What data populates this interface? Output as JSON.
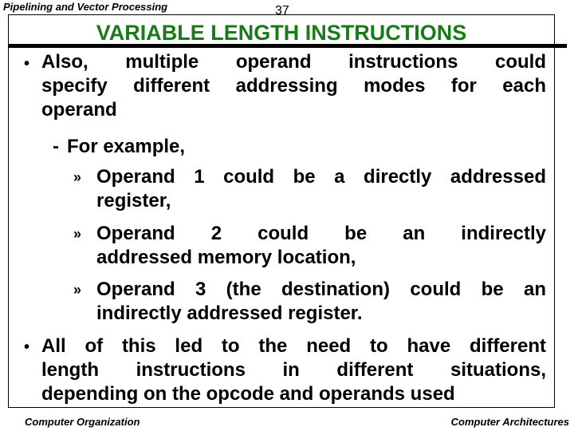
{
  "header": {
    "section_title": "Pipelining and Vector Processing",
    "page_number": "37"
  },
  "slide": {
    "title": "VARIABLE LENGTH INSTRUCTIONS",
    "title_color": "#1a7a1a",
    "bullets": [
      {
        "level": 1,
        "marker": "•",
        "lines": [
          "Also, multiple operand instructions could",
          "specify different addressing modes for each",
          "operand"
        ]
      },
      {
        "level": 2,
        "marker": "-",
        "lines": [
          "For example,"
        ]
      },
      {
        "level": 3,
        "marker": "»",
        "lines": [
          "Operand 1 could be a directly addressed",
          "register,"
        ]
      },
      {
        "level": 3,
        "marker": "»",
        "lines": [
          "Operand 2 could be an indirectly",
          "addressed memory location,"
        ]
      },
      {
        "level": 3,
        "marker": "»",
        "lines": [
          "Operand 3 (the destination) could be an",
          "indirectly addressed register."
        ]
      },
      {
        "level": 1,
        "marker": "•",
        "lines": [
          "All of this led to the need to have different",
          "length instructions in different situations,",
          "depending on the opcode and operands used"
        ]
      }
    ]
  },
  "footer": {
    "left": "Computer Organization",
    "right": "Computer Architectures"
  }
}
